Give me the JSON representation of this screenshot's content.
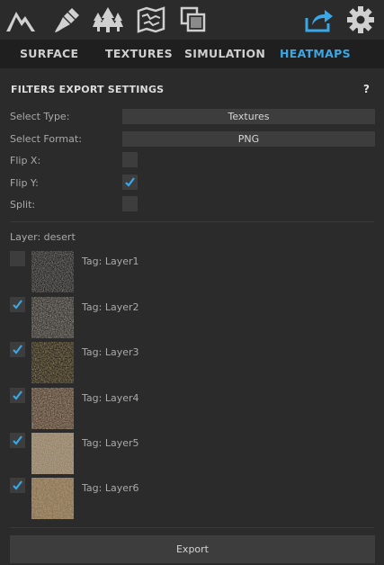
{
  "toolbar": {
    "icons": [
      "mountain-icon",
      "brush-icon",
      "trees-icon",
      "map-icon",
      "layers-icon",
      "export-icon",
      "gear-icon"
    ],
    "accent_color": "#3aa7e6"
  },
  "tabs": [
    {
      "label": "SURFACE",
      "active": false
    },
    {
      "label": "TEXTURES",
      "active": false
    },
    {
      "label": "SIMULATION",
      "active": false
    },
    {
      "label": "HEATMAPS",
      "active": true
    }
  ],
  "settings": {
    "title": "FILTERS EXPORT SETTINGS",
    "help": "?",
    "select_type_label": "Select Type:",
    "select_type_value": "Textures",
    "select_format_label": "Select Format:",
    "select_format_value": "PNG",
    "flip_x_label": "Flip X:",
    "flip_x": false,
    "flip_y_label": "Flip Y:",
    "flip_y": true,
    "split_label": "Split:",
    "split": false
  },
  "layer": {
    "title": "Layer: desert",
    "items": [
      {
        "tag": "Tag: Layer1",
        "checked": false,
        "texture": "dark-rock"
      },
      {
        "tag": "Tag: Layer2",
        "checked": true,
        "texture": "dark-gravel"
      },
      {
        "tag": "Tag: Layer3",
        "checked": true,
        "texture": "mossy-soil"
      },
      {
        "tag": "Tag: Layer4",
        "checked": true,
        "texture": "brown-dirt"
      },
      {
        "tag": "Tag: Layer5",
        "checked": true,
        "texture": "light-sand"
      },
      {
        "tag": "Tag: Layer6",
        "checked": true,
        "texture": "tan-sand"
      }
    ]
  },
  "export_label": "Export"
}
